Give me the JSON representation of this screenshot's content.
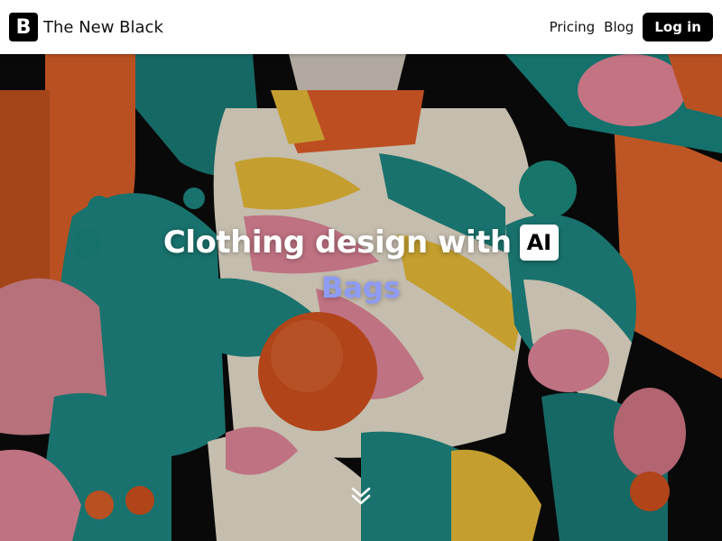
{
  "header": {
    "logo_glyph": "B",
    "brand_name": "The New Black",
    "nav": {
      "pricing": "Pricing",
      "blog": "Blog",
      "login": "Log in"
    }
  },
  "hero": {
    "headline": "Clothing design with",
    "badge": "AI",
    "rotating_word": "Bags",
    "scroll_icon": "double-chevron-down-icon"
  },
  "colors": {
    "header_bg": "#ffffff",
    "primary": "#000000",
    "accent_word": "#8e9cf5",
    "art_teal": "#1f8c86",
    "art_orange": "#e2622a",
    "art_yellow": "#f0c23a",
    "art_pink": "#e98b9f",
    "art_cream": "#f1e7d3"
  }
}
